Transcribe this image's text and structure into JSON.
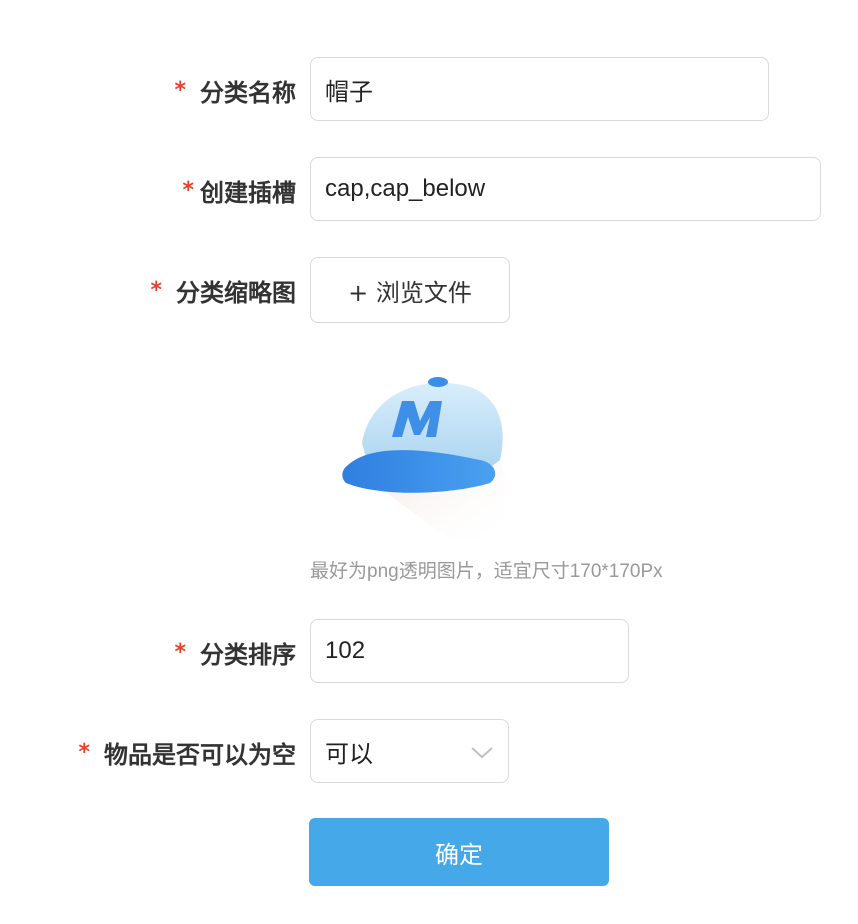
{
  "form": {
    "required_mark": "*",
    "category_name": {
      "label": "分类名称",
      "value": "帽子"
    },
    "slots": {
      "label": "创建插槽",
      "value": "cap,cap_below"
    },
    "thumbnail": {
      "label": "分类缩略图",
      "browse_label": "+ 浏览文件",
      "preview_icon": "blue-cap-icon",
      "hint": "最好为png透明图片，适宜尺寸170*170Px"
    },
    "sort_order": {
      "label": "分类排序",
      "value": "102"
    },
    "allow_empty": {
      "label": "物品是否可以为空",
      "value": "可以"
    },
    "confirm_label": "确定"
  },
  "colors": {
    "required": "#e8402f",
    "primary": "#45a8e8",
    "border": "#d9d9d9",
    "hint": "#999999"
  }
}
